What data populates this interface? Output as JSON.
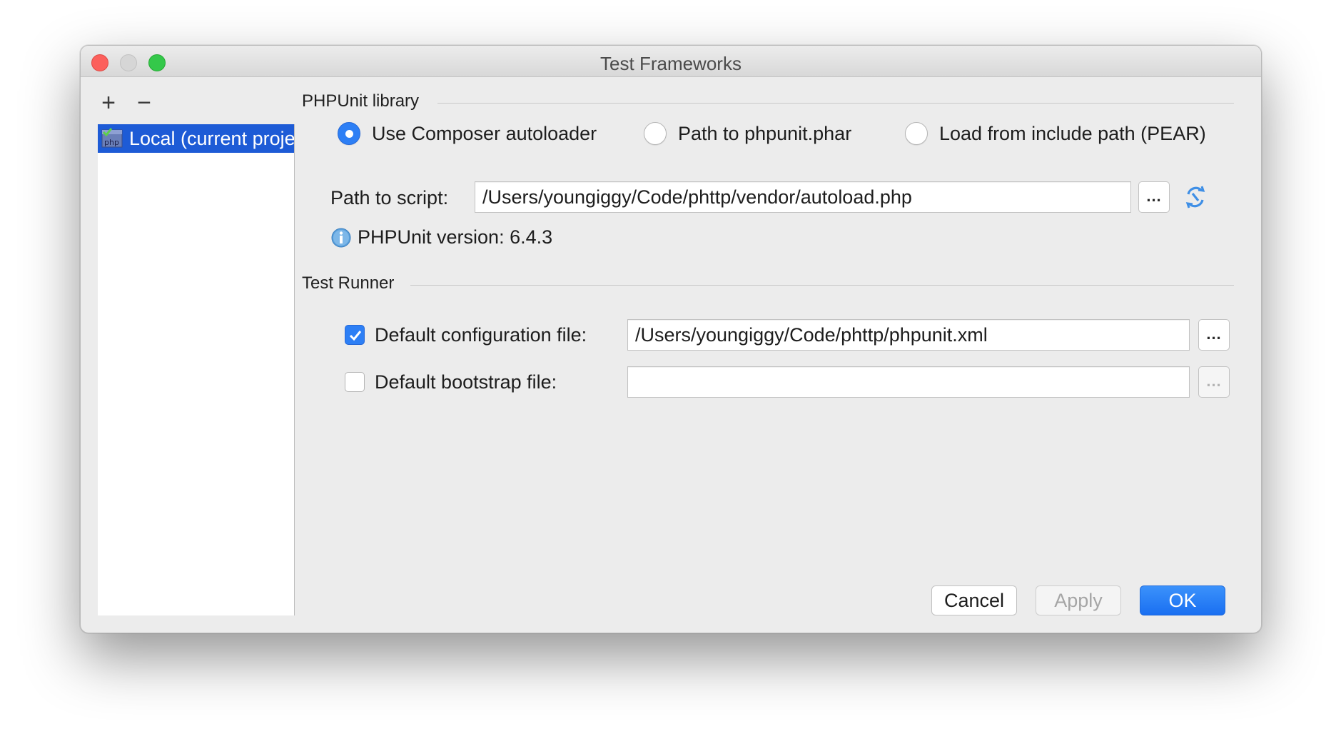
{
  "window": {
    "title": "Test Frameworks"
  },
  "sidebar": {
    "add_label": "+",
    "remove_label": "−",
    "items": [
      {
        "label": "Local (current project)",
        "selected": true,
        "icon": "php-interpreter-icon"
      }
    ]
  },
  "phpunit_library": {
    "section_title": "PHPUnit library",
    "options": [
      {
        "label": "Use Composer autoloader",
        "selected": true
      },
      {
        "label": "Path to phpunit.phar",
        "selected": false
      },
      {
        "label": "Load from include path (PEAR)",
        "selected": false
      }
    ],
    "path_label": "Path to script:",
    "path_value": "/Users/youngiggy/Code/phttp/vendor/autoload.php",
    "browse_label": "...",
    "version_text": "PHPUnit version: 6.4.3"
  },
  "test_runner": {
    "section_title": "Test Runner",
    "config": {
      "label": "Default configuration file:",
      "checked": true,
      "value": "/Users/youngiggy/Code/phttp/phpunit.xml",
      "browse_label": "..."
    },
    "bootstrap": {
      "label": "Default bootstrap file:",
      "checked": false,
      "value": "",
      "browse_label": "..."
    }
  },
  "buttons": {
    "cancel": "Cancel",
    "apply": "Apply",
    "ok": "OK"
  },
  "colors": {
    "accent": "#2d7ff5",
    "selection": "#1d5bd6",
    "close": "#fc605c",
    "maximize": "#34c84a"
  }
}
